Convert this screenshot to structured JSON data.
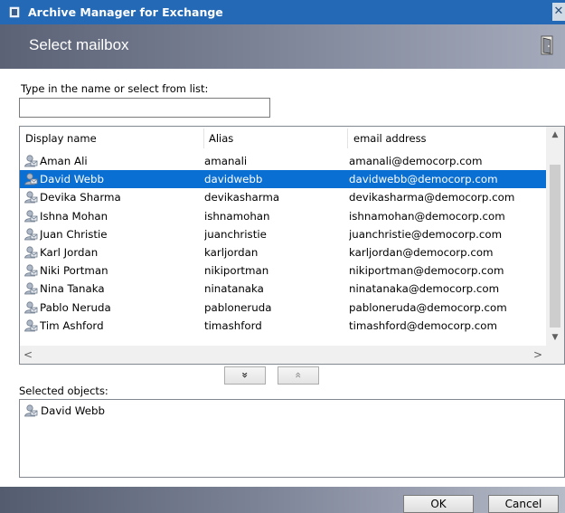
{
  "window": {
    "title": "Archive Manager for Exchange",
    "close_glyph": "✕",
    "title_icon": "app-icon",
    "close_icon": "close-icon"
  },
  "header": {
    "title": "Select mailbox",
    "icon": "door-icon"
  },
  "search": {
    "label": "Type in the name or select from list:",
    "value": "",
    "placeholder": ""
  },
  "list": {
    "columns": [
      "Display name",
      "Alias",
      "email address"
    ],
    "rows": [
      {
        "name": "Aman Ali",
        "alias": "amanali",
        "email": "amanali@democorp.com",
        "selected": false
      },
      {
        "name": "David Webb",
        "alias": "davidwebb",
        "email": "davidwebb@democorp.com",
        "selected": true
      },
      {
        "name": "Devika Sharma",
        "alias": "devikasharma",
        "email": "devikasharma@democorp.com",
        "selected": false
      },
      {
        "name": "Ishna Mohan",
        "alias": "ishnamohan",
        "email": "ishnamohan@democorp.com",
        "selected": false
      },
      {
        "name": "Juan Christie",
        "alias": "juanchristie",
        "email": "juanchristie@democorp.com",
        "selected": false
      },
      {
        "name": "Karl Jordan",
        "alias": "karljordan",
        "email": "karljordan@democorp.com",
        "selected": false
      },
      {
        "name": "Niki Portman",
        "alias": "nikiportman",
        "email": "nikiportman@democorp.com",
        "selected": false
      },
      {
        "name": "Nina Tanaka",
        "alias": "ninatanaka",
        "email": "ninatanaka@democorp.com",
        "selected": false
      },
      {
        "name": "Pablo Neruda",
        "alias": "pabloneruda",
        "email": "pabloneruda@democorp.com",
        "selected": false
      },
      {
        "name": "Tim Ashford",
        "alias": "timashford",
        "email": "timashford@democorp.com",
        "selected": false
      }
    ],
    "row_icon": "mailbox-icon",
    "scroll": {
      "up": "▲",
      "down": "▼",
      "left": "<",
      "right": ">"
    }
  },
  "move_buttons": {
    "add_glyph": "»",
    "remove_glyph": "«",
    "add_icon": "double-chevron-down-icon",
    "remove_icon": "double-chevron-up-icon"
  },
  "selected": {
    "label": "Selected objects:",
    "items": [
      "David Webb"
    ]
  },
  "footer": {
    "ok_label": "OK",
    "cancel_label": "Cancel"
  },
  "colors": {
    "titlebar": "#2369b5",
    "selection": "#0a6fd2"
  }
}
